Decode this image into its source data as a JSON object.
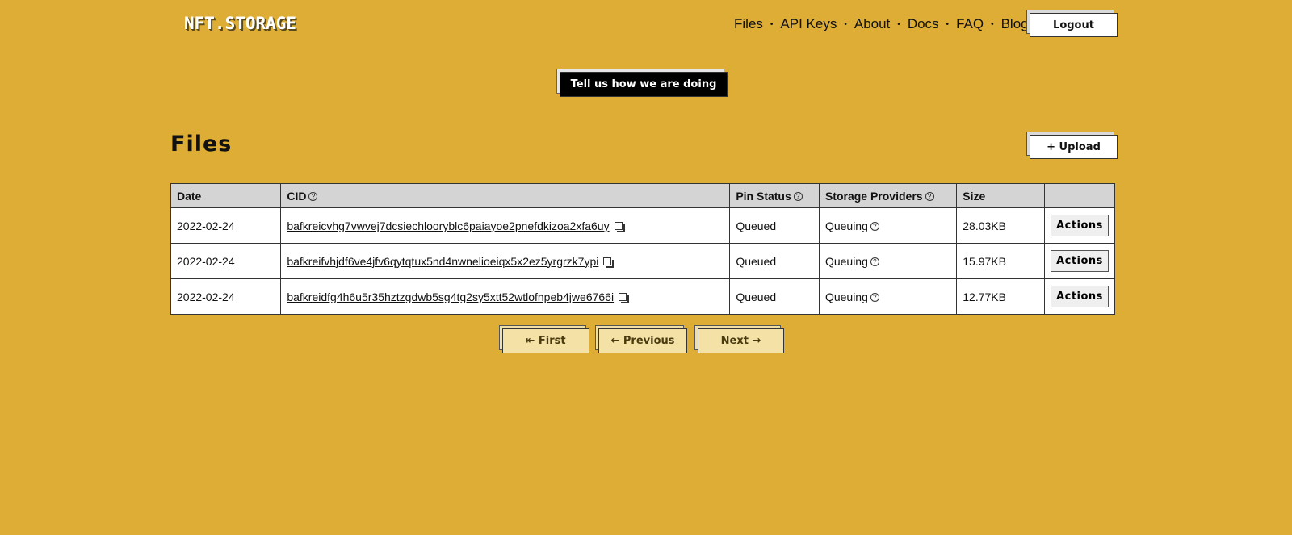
{
  "brand": {
    "logo_text": "NFT.STORAGE"
  },
  "nav": {
    "items": [
      {
        "label": "Files"
      },
      {
        "label": "API Keys"
      },
      {
        "label": "About"
      },
      {
        "label": "Docs"
      },
      {
        "label": "FAQ"
      },
      {
        "label": "Blog"
      }
    ],
    "separator": "•",
    "logout_label": "Logout"
  },
  "feedback": {
    "label": "Tell us how we are doing"
  },
  "page": {
    "title": "Files",
    "upload_label": "+ Upload"
  },
  "table": {
    "columns": [
      "Date",
      "CID",
      "Pin Status",
      "Storage Providers",
      "Size",
      ""
    ],
    "help_glyph": "?",
    "rows": [
      {
        "date": "2022-02-24",
        "cid": "bafkreicvhg7vwvej7dcsiechlooryblc6paiayoe2pnefdkizoa2xfa6uy",
        "pin_status": "Queued",
        "storage_providers": "Queuing",
        "size": "28.03KB",
        "action": "Actions"
      },
      {
        "date": "2022-02-24",
        "cid": "bafkreifvhjdf6ve4jfv6qytqtux5nd4nwnelioeiqx5x2ez5yrgrzk7ypi",
        "pin_status": "Queued",
        "storage_providers": "Queuing",
        "size": "15.97KB",
        "action": "Actions"
      },
      {
        "date": "2022-02-24",
        "cid": "bafkreidfg4h6u5r35hztzgdwb5sg4tg2sy5xtt52wtlofnpeb4jwe6766i",
        "pin_status": "Queued",
        "storage_providers": "Queuing",
        "size": "12.77KB",
        "action": "Actions"
      }
    ]
  },
  "pagination": {
    "first": "⇤ First",
    "previous": "← Previous",
    "next": "Next →"
  },
  "colors": {
    "background": "#ddad36",
    "header_row": "#d4d4d4",
    "pager_button": "#f3e1a6"
  }
}
